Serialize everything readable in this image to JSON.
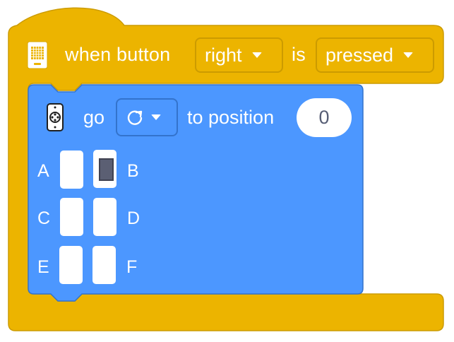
{
  "hat_block": {
    "icon": "hub-brick-icon",
    "when_button_label": "when button",
    "button_dropdown": {
      "value": "right"
    },
    "is_label": "is",
    "state_dropdown": {
      "value": "pressed"
    },
    "color": "#ecb400"
  },
  "motor_block": {
    "icon": "motor-icon",
    "go_label": "go",
    "direction_dropdown": {
      "icon": "clockwise-arrow-icon"
    },
    "to_position_label": "to position",
    "position_input": {
      "value": "0"
    },
    "color": "#4c97ff",
    "ports": [
      {
        "label": "A",
        "selected": false
      },
      {
        "label": "B",
        "selected": true
      },
      {
        "label": "C",
        "selected": false
      },
      {
        "label": "D",
        "selected": false
      },
      {
        "label": "E",
        "selected": false
      },
      {
        "label": "F",
        "selected": false
      }
    ]
  }
}
